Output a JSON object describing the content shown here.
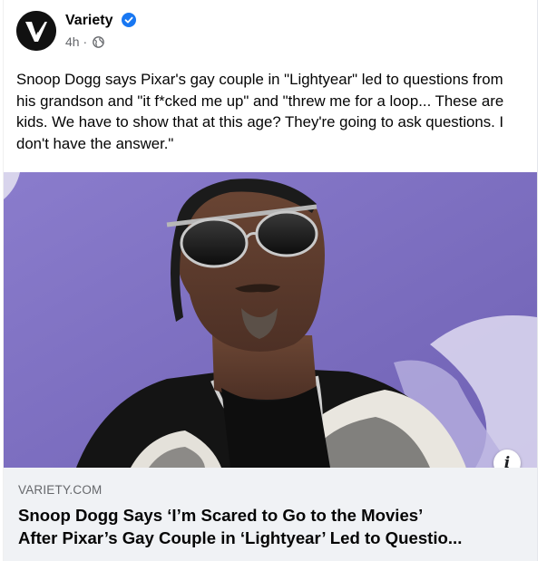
{
  "post": {
    "author": "Variety",
    "time": "4h",
    "separator": "·",
    "text": "Snoop Dogg says Pixar's gay couple in \"Lightyear\" led to questions from his grandson  and \"it f*cked me up\" and \"threw me for a loop... These are kids. We have to show that at this age? They're going to ask questions. I don't have the answer.\""
  },
  "link": {
    "domain": "VARIETY.COM",
    "headline_line1": "Snoop Dogg Says ‘I’m Scared to Go to the Movies’",
    "headline_line2": "After Pixar’s Gay Couple in ‘Lightyear’ Led to Questio..."
  },
  "icons": {
    "avatar": "variety-v-logo",
    "verified": "verified-badge-icon",
    "audience": "globe-icon",
    "info": "info-icon"
  },
  "colors": {
    "verified_blue": "#1877f2",
    "meta_gray": "#65676b",
    "preview_bg": "#f0f2f5",
    "photo_backdrop": "#7d6fc0"
  }
}
